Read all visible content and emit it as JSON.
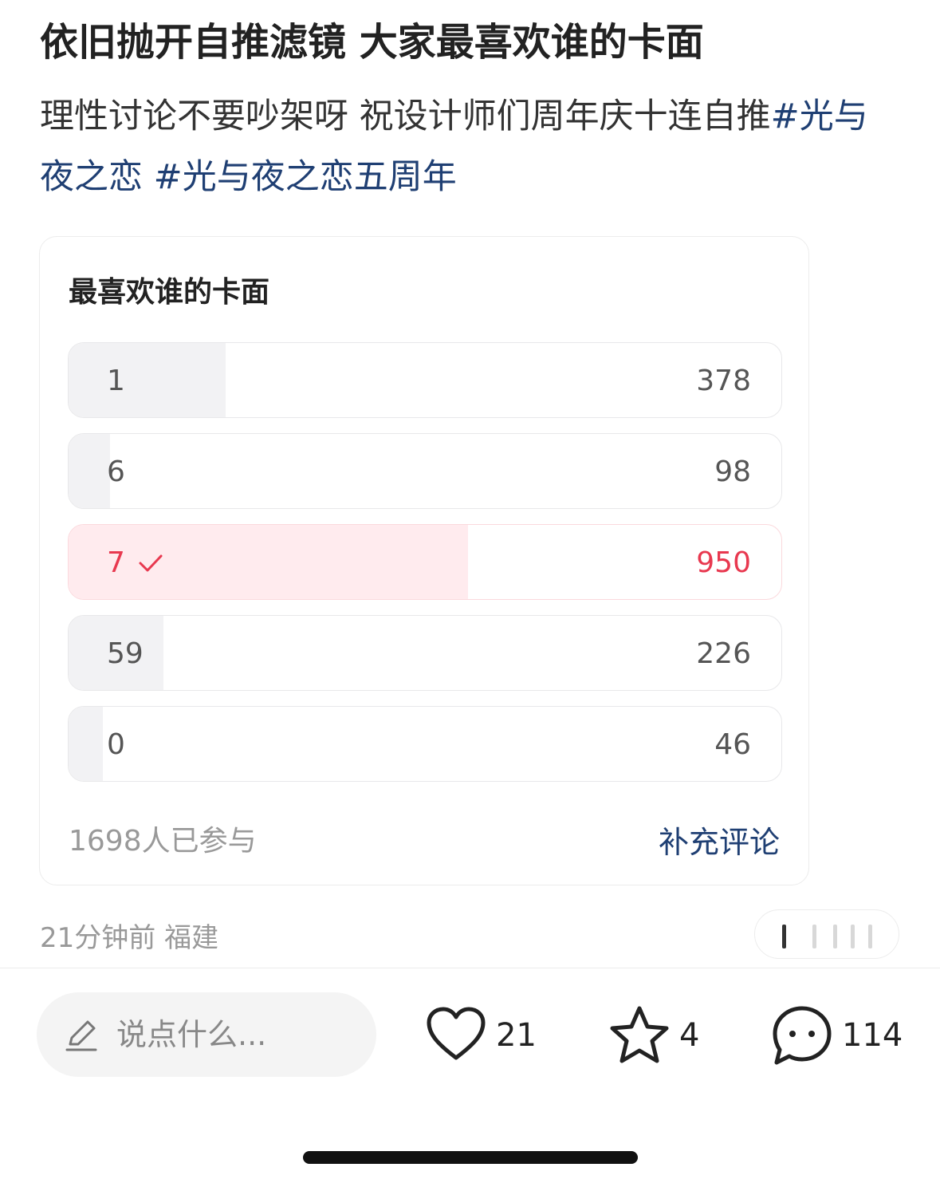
{
  "post": {
    "title": "依旧抛开自推滤镜 大家最喜欢谁的卡面",
    "description": "理性讨论不要吵架呀 祝设计师们周年庆十连自推",
    "tags": [
      "#光与夜之恋",
      "#光与夜之恋五周年"
    ]
  },
  "poll": {
    "title": "最喜欢谁的卡面",
    "options": [
      {
        "label": "1",
        "count": "378",
        "fraction": 0.22,
        "selected": false
      },
      {
        "label": "6",
        "count": "98",
        "fraction": 0.058,
        "selected": false
      },
      {
        "label": "7",
        "count": "950",
        "fraction": 0.56,
        "selected": true
      },
      {
        "label": "59",
        "count": "226",
        "fraction": 0.133,
        "selected": false
      },
      {
        "label": "0",
        "count": "46",
        "fraction": 0.048,
        "selected": false
      }
    ],
    "participants": "1698人已参与",
    "supplement_link": "补充评论"
  },
  "meta": {
    "time_location": "21分钟前 福建"
  },
  "bottom_bar": {
    "comment_placeholder": "说点什么...",
    "likes": "21",
    "favorites": "4",
    "comments": "114"
  }
}
